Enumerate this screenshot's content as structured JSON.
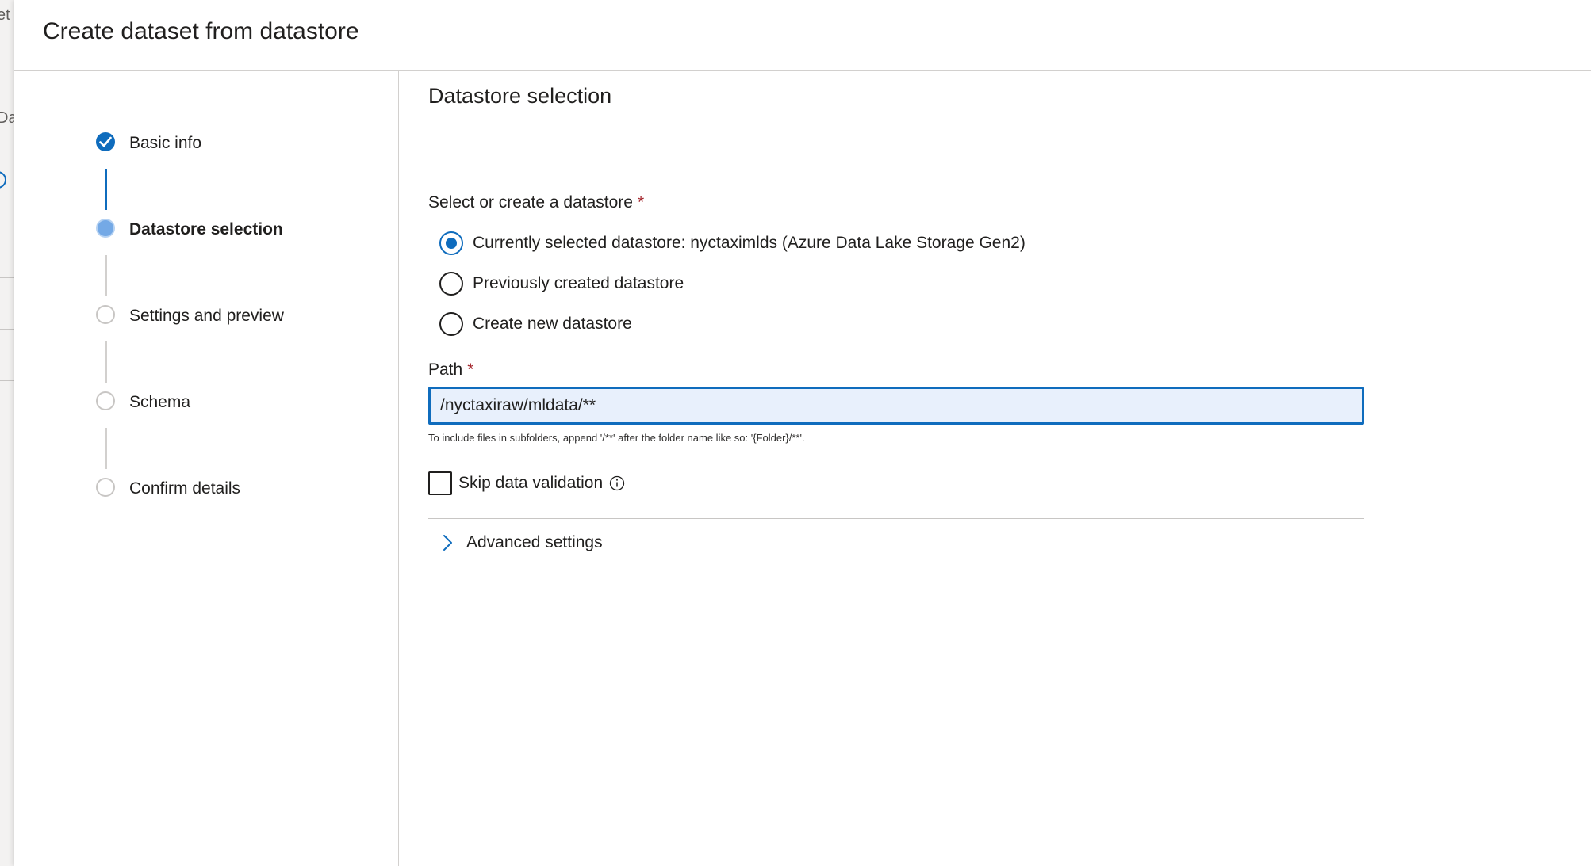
{
  "background": {
    "fragment_top": "et",
    "fragment_mid": "Da"
  },
  "panel": {
    "title": "Create dataset from datastore"
  },
  "stepper": {
    "steps": [
      {
        "label": "Basic info",
        "state": "completed"
      },
      {
        "label": "Datastore selection",
        "state": "current"
      },
      {
        "label": "Settings and preview",
        "state": "pending"
      },
      {
        "label": "Schema",
        "state": "pending"
      },
      {
        "label": "Confirm details",
        "state": "pending"
      }
    ]
  },
  "main": {
    "section_title": "Datastore selection",
    "datastore_group": {
      "label": "Select or create a datastore",
      "required_marker": "*",
      "options": [
        {
          "label": "Currently selected datastore: nyctaximlds (Azure Data Lake Storage Gen2)",
          "checked": true
        },
        {
          "label": "Previously created datastore",
          "checked": false
        },
        {
          "label": "Create new datastore",
          "checked": false
        }
      ]
    },
    "path": {
      "label": "Path",
      "required_marker": "*",
      "value": "/nyctaxiraw/mldata/**",
      "hint": "To include files in subfolders, append '/**' after the folder name like so: '{Folder}/**'."
    },
    "skip_validation": {
      "label": "Skip data validation",
      "checked": false,
      "info_icon": "info-icon"
    },
    "advanced": {
      "label": "Advanced settings",
      "icon": "chevron-right-icon"
    }
  },
  "colors": {
    "accent": "#0f6cbd",
    "current_step": "#74a9e6",
    "required": "#a4262c",
    "input_bg": "#e8f0fc"
  }
}
